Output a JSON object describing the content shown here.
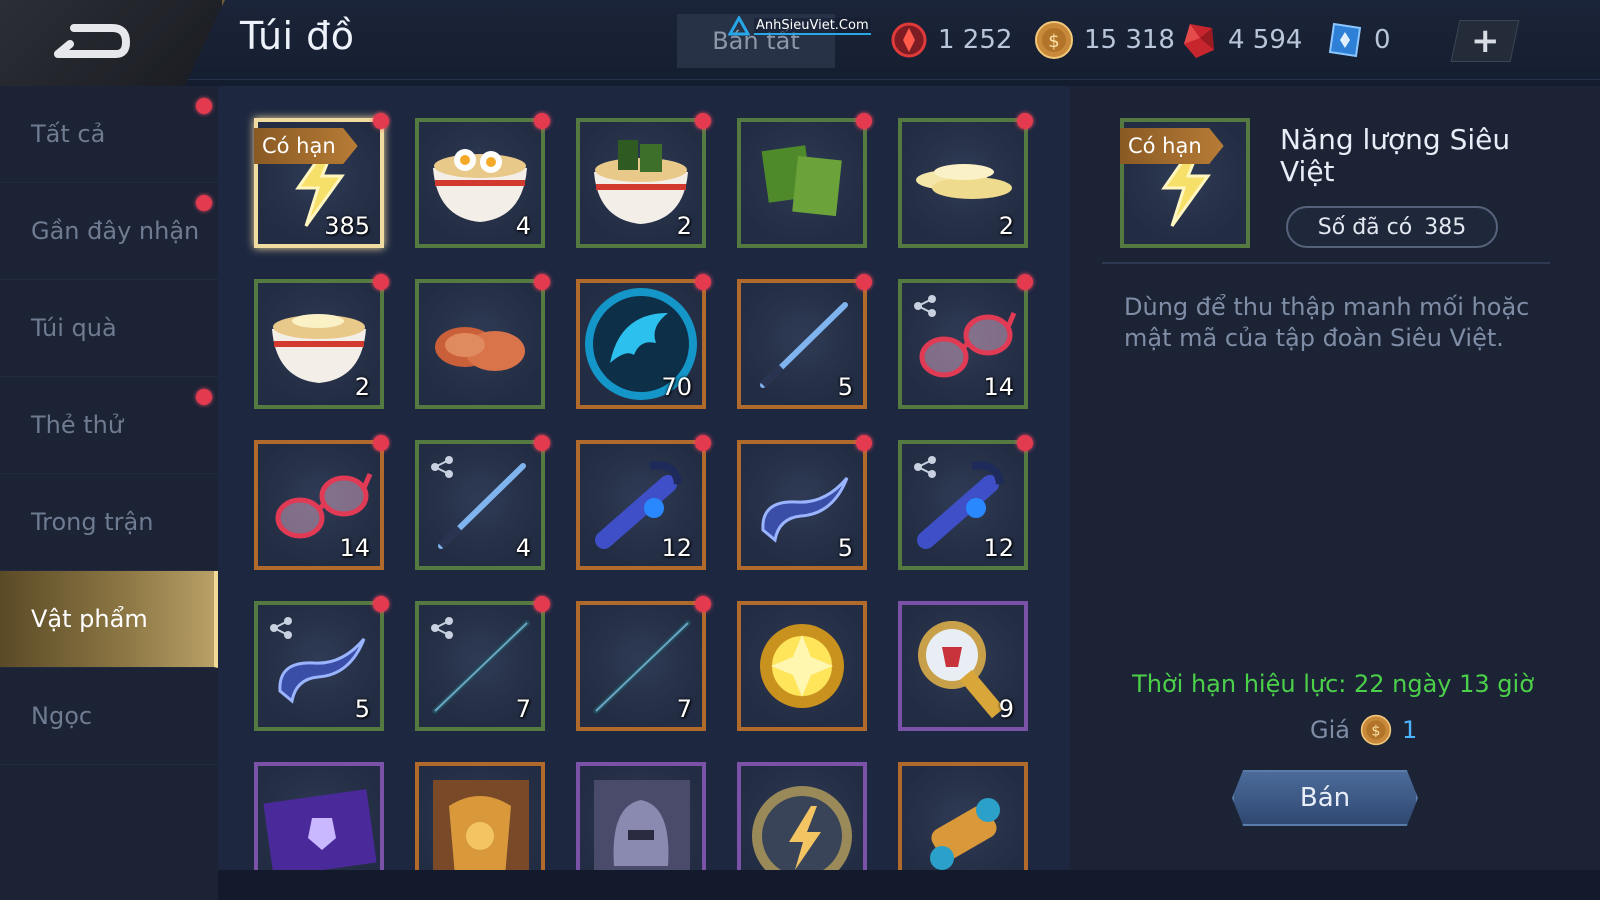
{
  "header": {
    "title": "Túi đồ",
    "sell_all_label": "Bán tất",
    "watermark": "AnhSieuViet.Com"
  },
  "currencies": [
    {
      "icon": "red-token-icon",
      "value": "1 252"
    },
    {
      "icon": "gold-coin-icon",
      "value": "15 318"
    },
    {
      "icon": "red-gem-icon",
      "value": "4 594"
    },
    {
      "icon": "blue-voucher-icon",
      "value": "0"
    }
  ],
  "add_label": "+",
  "sidebar": {
    "items": [
      {
        "label": "Tất cả",
        "dot": true
      },
      {
        "label": "Gần đây nhận",
        "dot": true
      },
      {
        "label": "Túi quà",
        "dot": false
      },
      {
        "label": "Thẻ thử",
        "dot": true
      },
      {
        "label": "Trong trận",
        "dot": false
      },
      {
        "label": "Vật phẩm",
        "dot": false,
        "active": true
      },
      {
        "label": "Ngọc",
        "dot": false
      }
    ]
  },
  "items": [
    {
      "icon": "lightning-energy-icon",
      "count": "385",
      "frame": "gold",
      "tag": "Có hạn",
      "dot": true
    },
    {
      "icon": "egg-noodle-bowl-icon",
      "count": "4",
      "frame": "green",
      "dot": true
    },
    {
      "icon": "seaweed-noodle-bowl-icon",
      "count": "2",
      "frame": "green",
      "dot": true
    },
    {
      "icon": "seaweed-sheets-icon",
      "count": "",
      "frame": "green",
      "dot": true
    },
    {
      "icon": "bamboo-shoots-icon",
      "count": "2",
      "frame": "green",
      "dot": true
    },
    {
      "icon": "bamboo-noodle-bowl-icon",
      "count": "2",
      "frame": "green",
      "dot": true
    },
    {
      "icon": "meat-slices-icon",
      "count": "",
      "frame": "green",
      "dot": true
    },
    {
      "icon": "dragon-emblem-icon",
      "count": "70",
      "frame": "orange",
      "dot": true
    },
    {
      "icon": "katana-icon",
      "count": "5",
      "frame": "orange",
      "dot": true
    },
    {
      "icon": "red-glasses-icon",
      "count": "14",
      "frame": "green",
      "dot": true,
      "share": true
    },
    {
      "icon": "red-glasses-icon",
      "count": "14",
      "frame": "orange",
      "dot": true
    },
    {
      "icon": "katana-icon",
      "count": "4",
      "frame": "green",
      "dot": true,
      "share": true
    },
    {
      "icon": "headset-icon",
      "count": "12",
      "frame": "orange",
      "dot": true
    },
    {
      "icon": "blade-hook-icon",
      "count": "5",
      "frame": "orange",
      "dot": true
    },
    {
      "icon": "headset-icon",
      "count": "12",
      "frame": "green",
      "dot": true,
      "share": true
    },
    {
      "icon": "blade-hook-icon",
      "count": "5",
      "frame": "green",
      "dot": true,
      "share": true
    },
    {
      "icon": "staff-icon",
      "count": "7",
      "frame": "green",
      "dot": true,
      "share": true
    },
    {
      "icon": "staff-icon",
      "count": "7",
      "frame": "orange",
      "dot": true
    },
    {
      "icon": "golden-orb-icon",
      "count": "",
      "frame": "orange",
      "dot": false
    },
    {
      "icon": "magic-mirror-icon",
      "count": "9",
      "frame": "purple",
      "dot": false
    },
    {
      "icon": "purple-card-icon",
      "count": "",
      "frame": "purple",
      "dot": false
    },
    {
      "icon": "armor-icon",
      "count": "",
      "frame": "orange",
      "dot": false
    },
    {
      "icon": "helmet-icon",
      "count": "",
      "frame": "purple",
      "dot": false
    },
    {
      "icon": "lightning-medal-icon",
      "count": "",
      "frame": "purple",
      "dot": false
    },
    {
      "icon": "scroll-icon",
      "count": "",
      "frame": "orange",
      "dot": false
    }
  ],
  "detail": {
    "tag": "Có hạn",
    "name": "Năng lượng Siêu Việt",
    "owned_label": "Số đã có",
    "owned_value": "385",
    "description": "Dùng để thu thập manh mối hoặc mật mã của tập đoàn Siêu Việt.",
    "expiry": "Thời hạn hiệu lực: 22 ngày 13 giờ",
    "price_label": "Giá",
    "price_value": "1",
    "sell_label": "Bán"
  },
  "colors": {
    "frame_green": "#547a42",
    "frame_orange": "#b06a2c",
    "frame_purple": "#7a52a8",
    "frame_gold": "#f0dba0",
    "expiry_green": "#4cd04a",
    "notification_red": "#e43a4f"
  }
}
